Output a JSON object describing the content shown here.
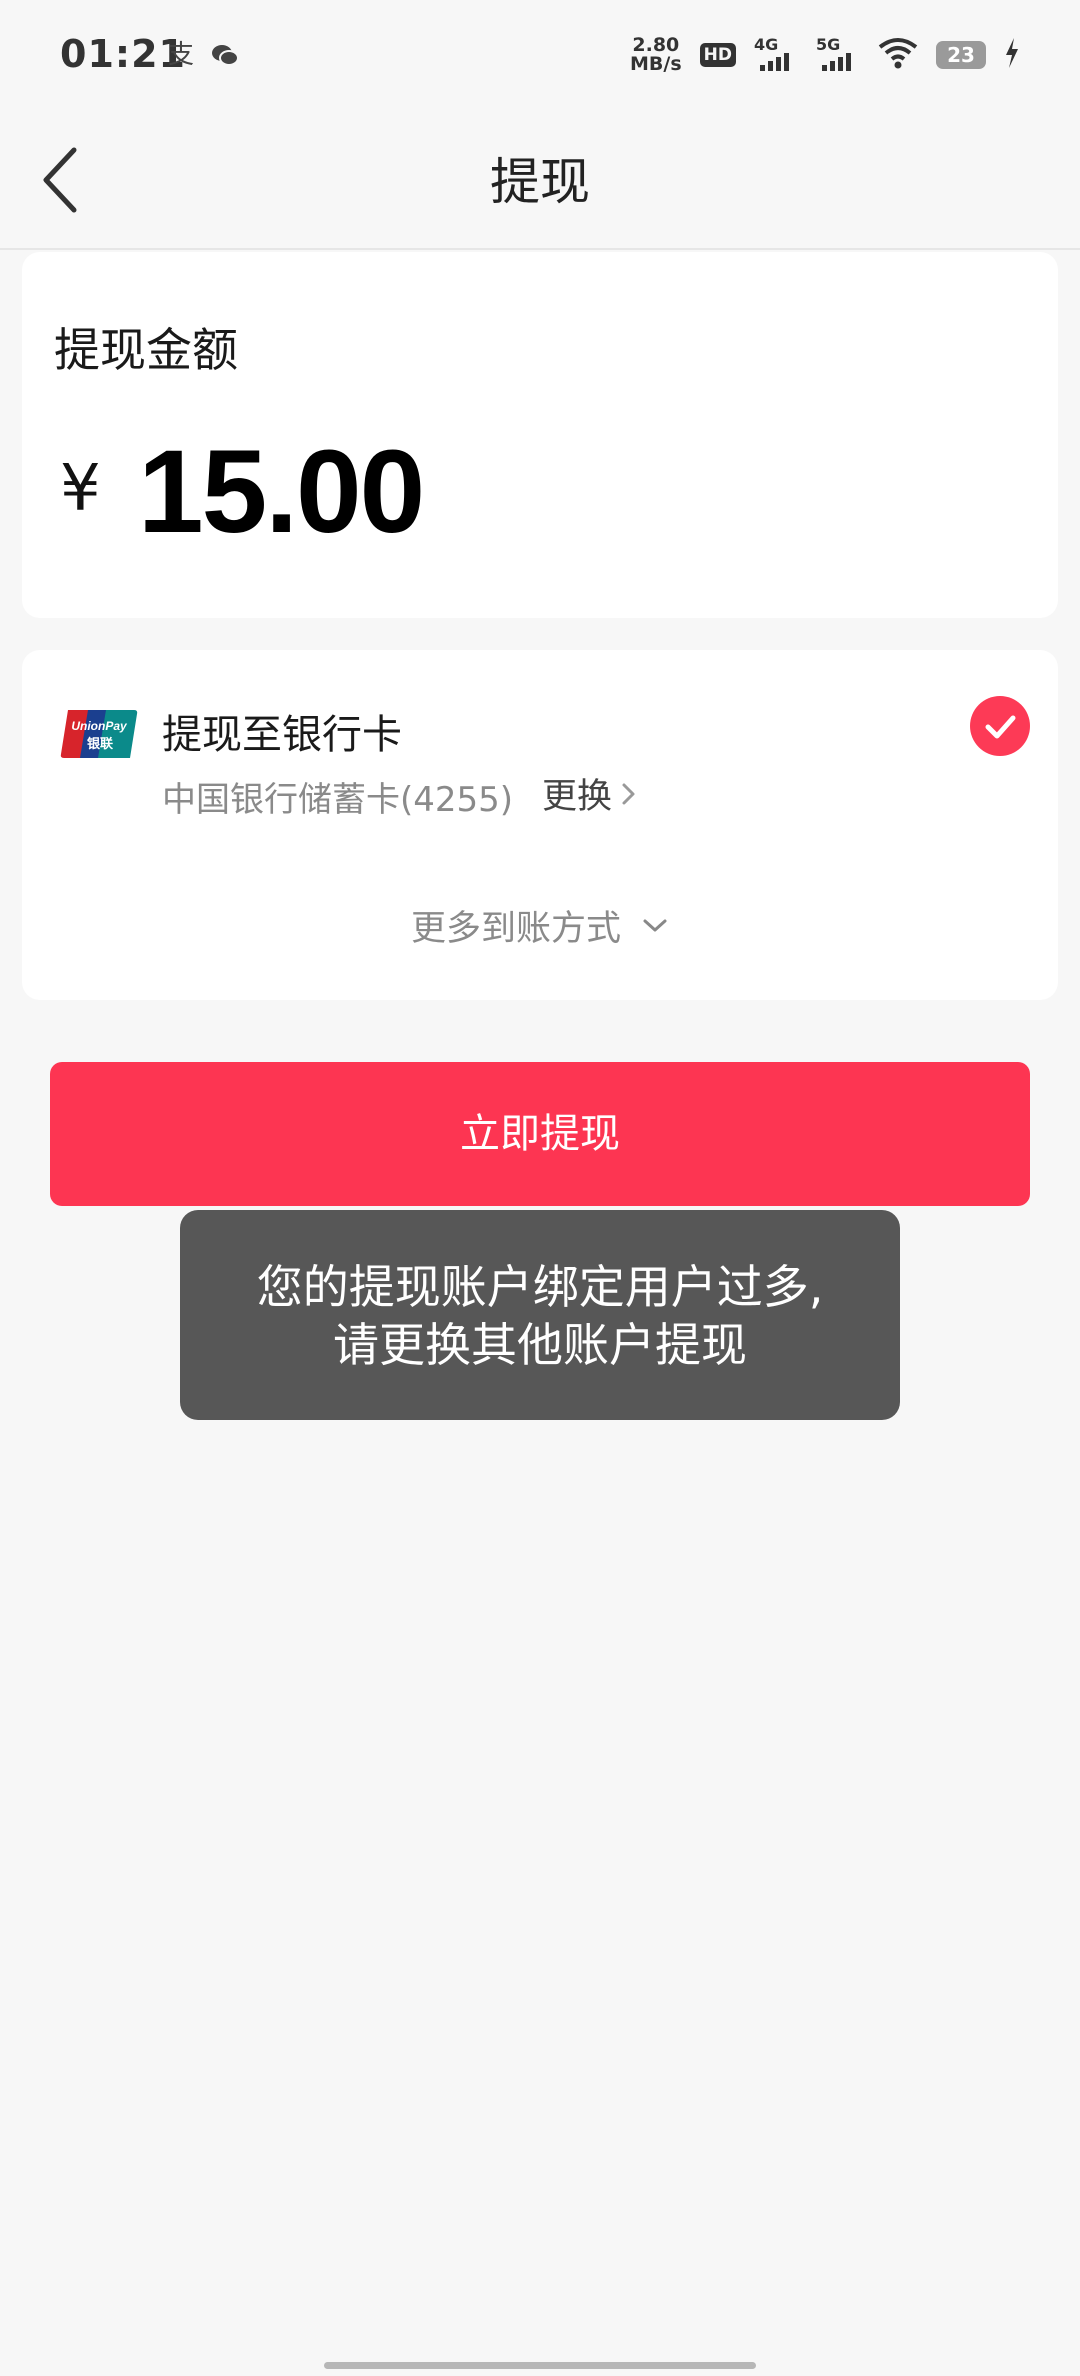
{
  "status_bar": {
    "time": "01:21",
    "app_icons": [
      "alipay-icon",
      "wechat-icon"
    ],
    "net_speed_value": "2.80",
    "net_speed_unit": "MB/s",
    "hd_label": "HD",
    "network_1": "4G",
    "network_2": "5G",
    "battery": "23"
  },
  "nav": {
    "title": "提现"
  },
  "amount": {
    "label": "提现金额",
    "currency": "¥",
    "value": "15.00"
  },
  "method": {
    "title": "提现至银行卡",
    "card_name": "中国银行储蓄卡(4255)",
    "change_label": "更换",
    "more_label": "更多到账方式",
    "logo_text_top": "UnionPay",
    "logo_text_bottom": "银联",
    "selected": true
  },
  "withdraw_button": {
    "label": "立即提现"
  },
  "toast": {
    "line1": "您的提现账户绑定用户过多,",
    "line2": "请更换其他账户提现"
  },
  "colors": {
    "accent": "#fd3552",
    "background": "#f7f7f7",
    "toast_bg": "#575757"
  }
}
